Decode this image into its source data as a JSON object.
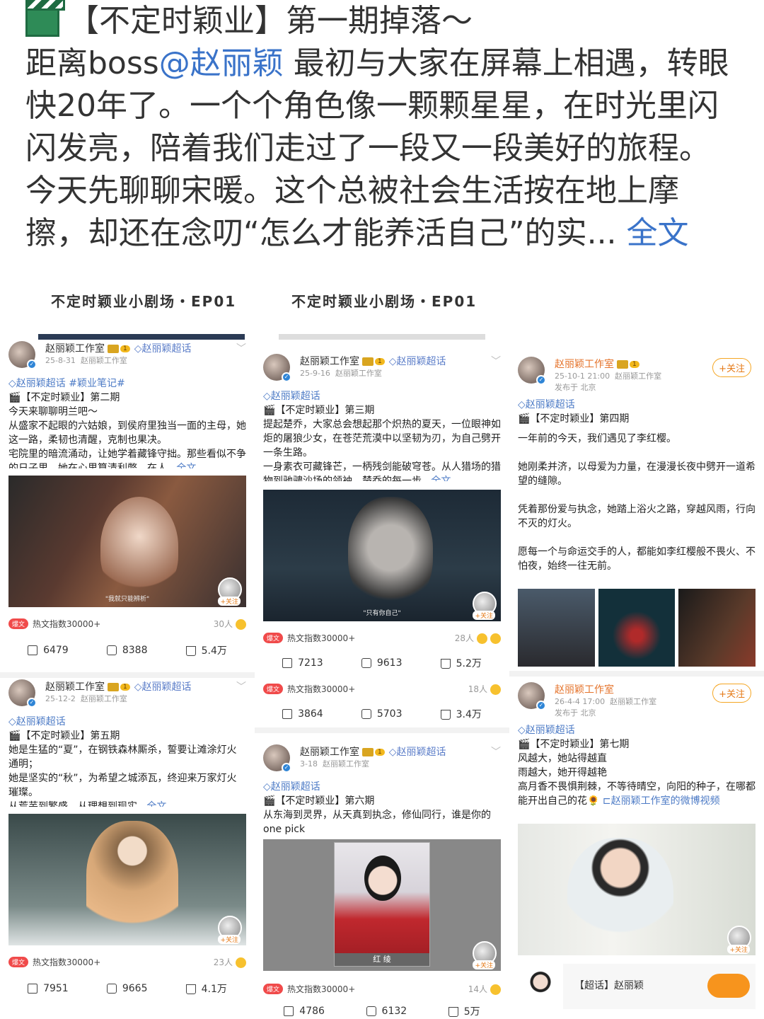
{
  "header": {
    "title": "【不定时颖业】第一期掉落～",
    "line1_pre": "距离boss",
    "line1_mention": "@赵丽颖",
    "line1_post": " 最初与大家在屏幕上相遇，转眼",
    "line2": "快20年了。一个个角色像一颗颗星星，在时光里闪",
    "line3": "闪发亮，陪着我们走过了一段又一段美好的旅程。",
    "line4": "今天先聊聊宋暖。这个总被社会生活按在地上摩",
    "line5_pre": "擦，却还在念叨“怎么才能养活自己”的实...",
    "line5_more": " 全文"
  },
  "ep_labels": [
    "不定时颖业小剧场・EP01",
    "不定时颖业小剧场・EP01"
  ],
  "common": {
    "studio": "赵丽颖工作室",
    "super": "赵丽颖超话",
    "follow": "+关注",
    "hot": "热文指数30000+",
    "hot_badge": "爆文",
    "mini_follow": "+关注"
  },
  "posts": [
    {
      "id": "p2",
      "date": "25-8-31",
      "source": "赵丽颖工作室",
      "tag": "◇赵丽颖超话 #颖业笔记#",
      "title": "【不定时颖业】第二期",
      "body": "今天来聊聊明兰吧～\n从盛家不起眼的六姑娘，到侯府里独当一面的主母，她这一路，柔韧也清醒，克制也果决。\n宅院里的暗流涌动，让她学着藏锋守拙。那些看似不争的日子里，她在心里算清利弊，在人...",
      "more": "全文",
      "caption": "\"我就只能辨析\"",
      "viewers": "30人",
      "share": "6479",
      "comment": "8388",
      "like": "5.4万"
    },
    {
      "id": "p3",
      "date": "25-9-16",
      "source": "赵丽颖工作室",
      "tag": "◇赵丽颖超话",
      "title": "【不定时颖业】第三期",
      "body": "提起楚乔，大家总会想起那个炽热的夏天，一位眼神如炬的屠狼少女，在苍茫荒漠中以坚韧为刃，为自己劈开一条生路。\n一身素衣可藏锋芒，一柄残剑能破穹苍。从人猎场的猎物到驰骋沙场的领袖，楚乔的每一步...",
      "more": "全文",
      "caption": "\"只有你自己\"",
      "viewers": "28人",
      "share": "7213",
      "comment": "9613",
      "like": "5.2万"
    },
    {
      "id": "p3b",
      "viewers": "18人",
      "share": "3864",
      "comment": "5703",
      "like": "3.4万"
    },
    {
      "id": "p4",
      "date": "25-10-1 21:00",
      "source": "赵丽颖工作室",
      "loc": "发布于 北京",
      "tag": "◇赵丽颖超话",
      "title": "【不定时颖业】第四期",
      "body": "一年前的今天，我们遇见了李红樱。\n\n她刚柔并济，以母爱为力量，在漫漫长夜中劈开一道希望的缝隙。\n\n凭着那份爱与执念，她踏上浴火之路，穿越风雨，行向不灭的灯火。\n\n愿每一个与命运交手的人，都能如李红樱般不畏火、不怕夜，始终一往无前。"
    },
    {
      "id": "p5",
      "date": "25-12-2",
      "source": "赵丽颖工作室",
      "tag": "◇赵丽颖超话",
      "title": "【不定时颖业】第五期",
      "body": "她是生猛的“夏”，在钢铁森林厮杀，誓要让滩涂灯火通明；\n她是坚实的“秋”，为希望之城添瓦，终迎来万家灯火璀璨。\n从荒芜到繁盛，从理想到现实...",
      "more": "全文",
      "viewers": "23人",
      "share": "7951",
      "comment": "9665",
      "like": "4.1万"
    },
    {
      "id": "p6",
      "date": "3-18",
      "source": "赵丽颖工作室",
      "tag": "◇赵丽颖超话",
      "title": "【不定时颖业】第六期",
      "body": "从东海到灵界，从天真到执念，修仙同行，谁是你的one pick",
      "photo_label": "红 绫",
      "viewers": "14人",
      "share": "4786",
      "comment": "6132",
      "like": "5万"
    },
    {
      "id": "p7",
      "date": "26-4-4 17:00",
      "source": "赵丽颖工作室",
      "loc": "发布于 北京",
      "tag": "◇赵丽颖超话",
      "title": "【不定时颖业】第七期",
      "body": "风越大，她站得越直\n雨越大，她开得越艳\n高月香不畏惧荆棘，不等待晴空，向阳的种子，在哪都能开出自己的花",
      "video_link": "赵丽颖工作室的微博视频",
      "bottom_text": "【超话】赵丽颖"
    }
  ]
}
